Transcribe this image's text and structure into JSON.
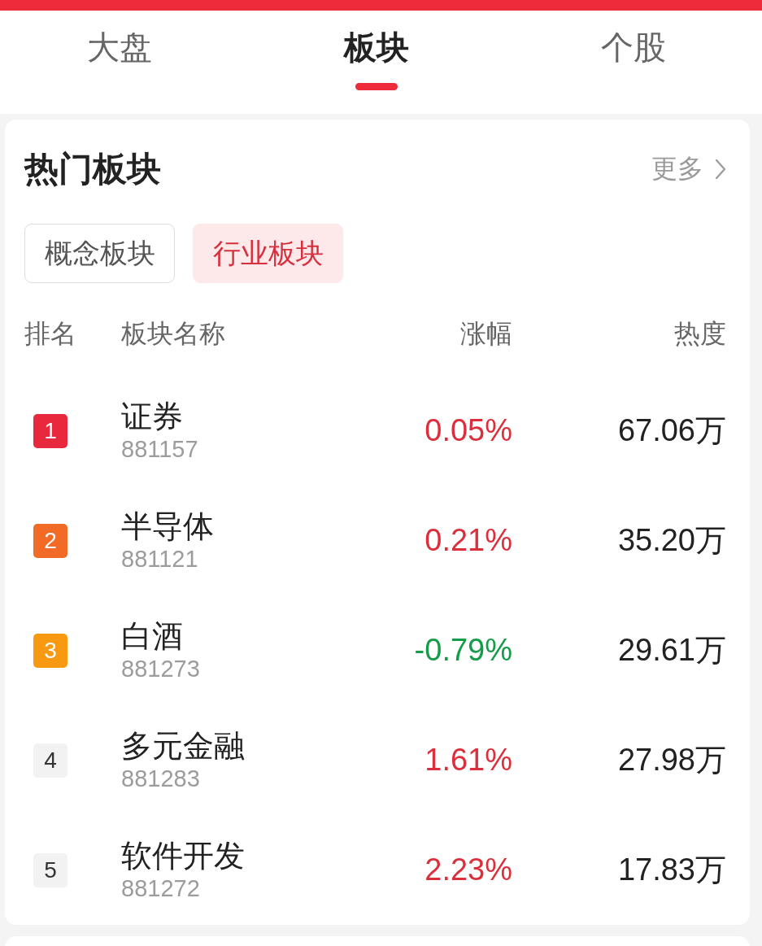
{
  "tabs": [
    {
      "label": "大盘",
      "selected": false
    },
    {
      "label": "板块",
      "selected": true
    },
    {
      "label": "个股",
      "selected": false
    }
  ],
  "hot_sectors": {
    "title": "热门板块",
    "more_link": "更多",
    "segments": [
      {
        "label": "概念板块",
        "selected": false
      },
      {
        "label": "行业板块",
        "selected": true
      }
    ],
    "columns": [
      "排名",
      "板块名称",
      "涨幅",
      "热度"
    ],
    "rows": [
      {
        "rank": "1",
        "color": "#e8283c",
        "name": "证券",
        "code": "881157",
        "change": "0.05%",
        "rising": true,
        "heat": "67.06万"
      },
      {
        "rank": "2",
        "color": "#f26b26",
        "name": "半导体",
        "code": "881121",
        "change": "0.21%",
        "rising": true,
        "heat": "35.20万"
      },
      {
        "rank": "3",
        "color": "#f79a12",
        "name": "白酒",
        "code": "881273",
        "change": "-0.79%",
        "rising": false,
        "heat": "29.61万"
      },
      {
        "rank": "4",
        "color": "#f2f2f2",
        "name": "多元金融",
        "code": "881283",
        "change": "1.61%",
        "rising": true,
        "heat": "27.98万"
      },
      {
        "rank": "5",
        "color": "#f2f2f2",
        "name": "软件开发",
        "code": "881272",
        "change": "2.23%",
        "rising": true,
        "heat": "17.83万"
      }
    ]
  }
}
